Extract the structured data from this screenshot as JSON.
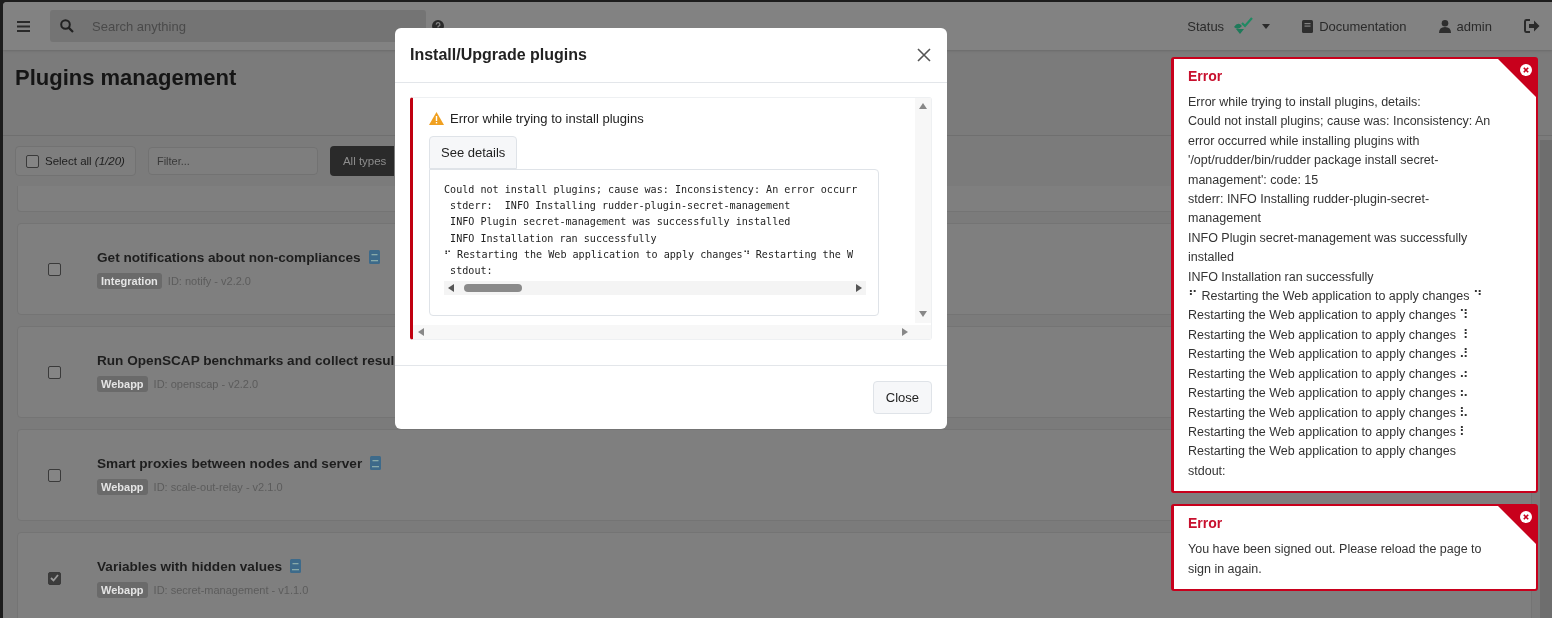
{
  "topbar": {
    "search": {
      "placeholder": "Search anything"
    },
    "status_label": "Status",
    "documentation_label": "Documentation",
    "user_label": "admin"
  },
  "page": {
    "title": "Plugins management"
  },
  "toolbar": {
    "select_all": {
      "label": "Select all *(1/20)*",
      "checked": false
    },
    "filter": {
      "placeholder": "Filter..."
    },
    "type_button": "All types"
  },
  "plugins": [
    {
      "name": "Get notifications about non-compliances",
      "badge": "Integration",
      "id_text": "ID: notify - v2.2.0",
      "checked": false,
      "has_doc": true
    },
    {
      "name": "Run OpenSCAP benchmarks and collect resul",
      "badge": "Webapp",
      "id_text": "ID: openscap - v2.2.0",
      "checked": false,
      "has_doc": false
    },
    {
      "name": "Smart proxies between nodes and server",
      "badge": "Webapp",
      "id_text": "ID: scale-out-relay - v2.1.0",
      "checked": false,
      "has_doc": true
    },
    {
      "name": "Variables with hidden values",
      "badge": "Webapp",
      "id_text": "ID: secret-management - v1.1.0",
      "checked": true,
      "has_doc": true
    }
  ],
  "modal": {
    "title": "Install/Upgrade plugins",
    "alert": "Error while trying to install plugins",
    "details_button": "See details",
    "details_lines": [
      "Could not install plugins; cause was: Inconsistency: An error occurr",
      " stderr:  INFO Installing rudder-plugin-secret-management",
      " INFO Plugin secret-management was successfully installed",
      " INFO Installation ran successfully",
      "⠋ Restarting the Web application to apply changes⠙ Restarting the W",
      " stdout:"
    ],
    "close_button": "Close"
  },
  "toasts": [
    {
      "title": "Error",
      "lines": [
        "Error while trying to install plugins, details:",
        "Could not install plugins; cause was: Inconsistency: An error occurred while installing plugins with '/opt/rudder/bin/rudder package install secret-management': code: 15",
        "stderr: INFO Installing rudder-plugin-secret-management",
        "INFO Plugin secret-management was successfully installed",
        "INFO Installation ran successfully",
        "⠋ Restarting the Web application to apply changes ⠙",
        "Restarting the Web application to apply changes ⠹",
        "Restarting the Web application to apply changes ⠸",
        "Restarting the Web application to apply changes ⠼",
        "Restarting the Web application to apply changes ⠴",
        "Restarting the Web application to apply changes ⠦",
        "Restarting the Web application to apply changes ⠧",
        "Restarting the Web application to apply changes ⠇",
        "Restarting the Web application to apply changes",
        "stdout:"
      ]
    },
    {
      "title": "Error",
      "lines": [
        "You have been signed out. Please reload the page to sign in again."
      ]
    }
  ]
}
